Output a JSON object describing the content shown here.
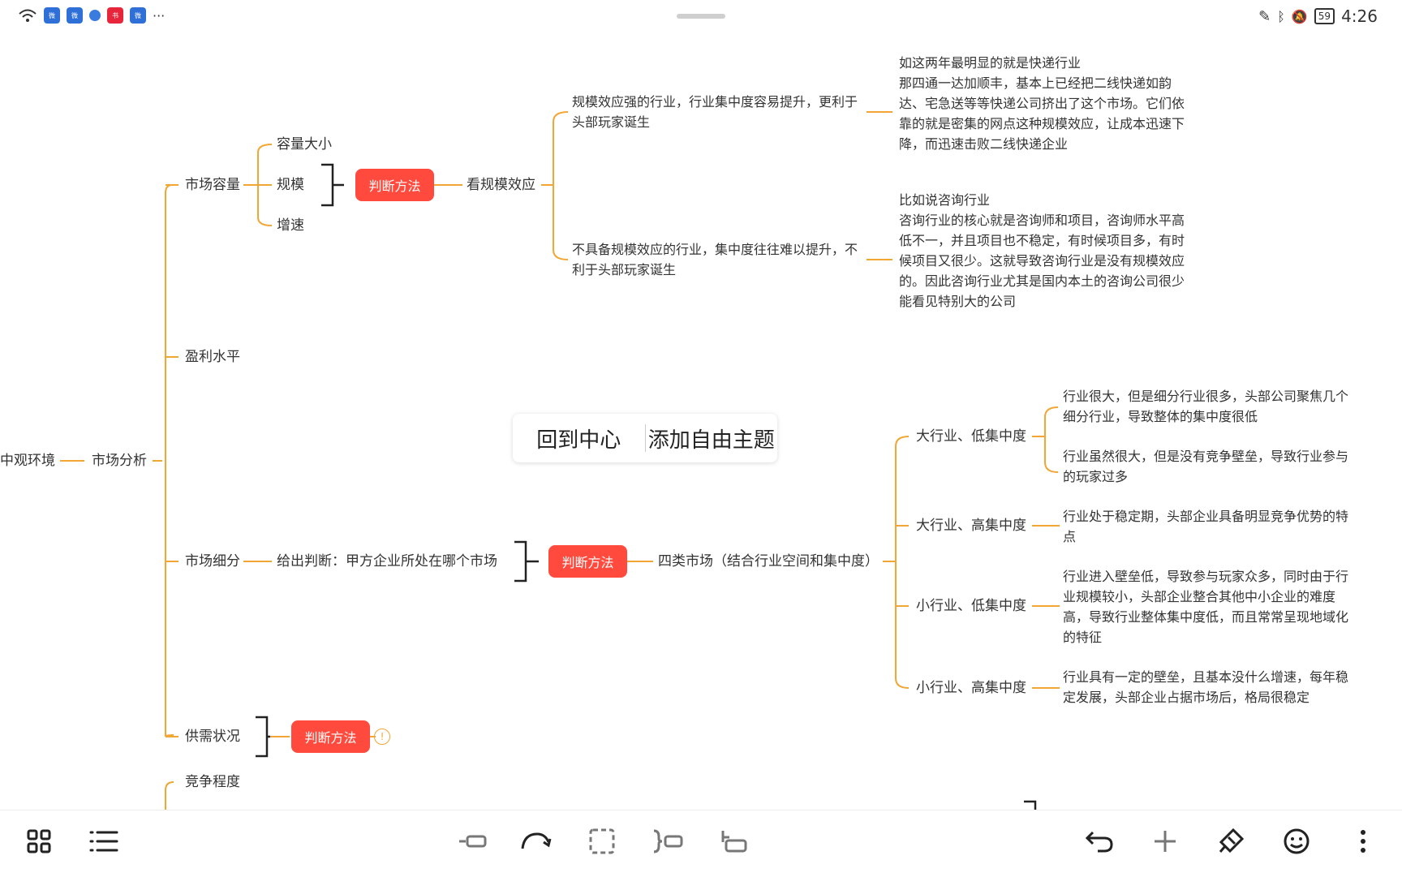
{
  "status_bar": {
    "time": "4:26",
    "battery": "59",
    "signal_label": "6",
    "more": "···"
  },
  "floating_menu": {
    "back_to_center": "回到中心",
    "add_free_topic": "添加自由主题"
  },
  "mindmap": {
    "root": "中观环境",
    "market_analysis": "市场分析",
    "market_capacity": "市场容量",
    "capacity_size": "容量大小",
    "scale": "规模",
    "growth": "增速",
    "judge_method_1": "判断方法",
    "look_scale_effect": "看规模效应",
    "strong_scale": "规模效应强的行业，行业集中度容易提升，更利于头部玩家诞生",
    "strong_scale_example": "如这两年最明显的就是快递行业\n那四通一达加顺丰，基本上已经把二线快递如韵达、宅急送等等快递公司挤出了这个市场。它们依靠的就是密集的网点这种规模效应，让成本迅速下降，而迅速击败二线快递企业",
    "no_scale": "不具备规模效应的行业，集中度往往难以提升，不利于头部玩家诞生",
    "no_scale_example": "比如说咨询行业\n咨询行业的核心就是咨询师和项目，咨询师水平高低不一，并且项目也不稳定，有时候项目多，有时候项目又很少。这就导致咨询行业是没有规模效应的。因此咨询行业尤其是国内本土的咨询公司很少能看见特别大的公司",
    "profit_level": "盈利水平",
    "market_segment": "市场细分",
    "give_judgment": "给出判断：甲方企业所处在哪个市场",
    "judge_method_2": "判断方法",
    "four_markets": "四类市场（结合行业空间和集中度）",
    "big_low": "大行业、低集中度",
    "big_low_1": "行业很大，但是细分行业很多，头部公司聚焦几个细分行业，导致整体的集中度很低",
    "big_low_2": "行业虽然很大，但是没有竞争壁垒，导致行业参与的玩家过多",
    "big_high": "大行业、高集中度",
    "big_high_1": "行业处于稳定期，头部企业具备明显竞争优势的特点",
    "small_low": "小行业、低集中度",
    "small_low_1": "行业进入壁垒低，导致参与玩家众多，同时由于行业规模较小，头部企业整合其他中小企业的难度高，导致行业整体集中度低，而且常常呈现地域化的特征",
    "small_high": "小行业、高集中度",
    "small_high_1": "行业具有一定的壁垒，且基本没什么增速，每年稳定发展，头部企业占据市场后，格局很稳定",
    "supply_demand": "供需状况",
    "judge_method_3": "判断方法",
    "info_badge": "!",
    "competition": "竞争程度"
  },
  "colors": {
    "branch": "#f2a634",
    "pill": "#ff4a3d",
    "bracket": "#222222"
  },
  "toolbar": {
    "left": [
      "grid-icon",
      "outline-icon"
    ],
    "center": [
      "insert-child-icon",
      "redo-arrow-icon",
      "select-box-icon",
      "summary-icon",
      "insert-sibling-icon"
    ],
    "right": [
      "undo-icon",
      "add-icon",
      "style-brush-icon",
      "emoji-icon",
      "more-vertical-icon"
    ]
  }
}
